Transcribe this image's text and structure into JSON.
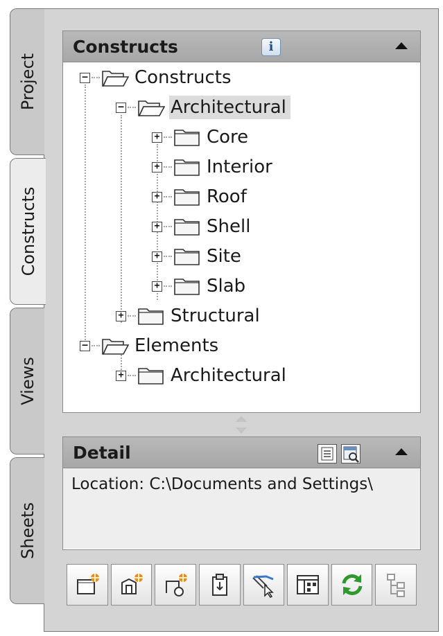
{
  "tabs": [
    {
      "label": "Project",
      "active": false
    },
    {
      "label": "Constructs",
      "active": true
    },
    {
      "label": "Views",
      "active": false
    },
    {
      "label": "Sheets",
      "active": false
    }
  ],
  "constructs_panel": {
    "title": "Constructs",
    "info_icon": "info-icon",
    "tree": [
      {
        "label": "Constructs",
        "state": "expanded",
        "icon": "folder-open-icon",
        "depth": 0
      },
      {
        "label": "Architectural",
        "state": "expanded",
        "icon": "folder-open-icon",
        "depth": 1,
        "selected": true
      },
      {
        "label": "Core",
        "state": "collapsed",
        "icon": "folder-icon",
        "depth": 2
      },
      {
        "label": "Interior",
        "state": "collapsed",
        "icon": "folder-icon",
        "depth": 2
      },
      {
        "label": "Roof",
        "state": "collapsed",
        "icon": "folder-icon",
        "depth": 2
      },
      {
        "label": "Shell",
        "state": "collapsed",
        "icon": "folder-icon",
        "depth": 2
      },
      {
        "label": "Site",
        "state": "collapsed",
        "icon": "folder-icon",
        "depth": 2
      },
      {
        "label": "Slab",
        "state": "collapsed",
        "icon": "folder-icon",
        "depth": 2
      },
      {
        "label": "Structural",
        "state": "collapsed",
        "icon": "folder-icon",
        "depth": 1
      },
      {
        "label": "Elements",
        "state": "expanded",
        "icon": "folder-open-icon",
        "depth": 0
      },
      {
        "label": "Architectural",
        "state": "collapsed",
        "icon": "folder-icon",
        "depth": 1
      }
    ]
  },
  "detail_panel": {
    "title": "Detail",
    "location_text": "Location: C:\\Documents and Settings\\",
    "icons": [
      "list-view-icon",
      "preview-icon"
    ]
  },
  "toolbar": {
    "buttons": [
      "new-category-icon",
      "new-construct-icon",
      "new-element-icon",
      "paste-icon",
      "xref-select-icon",
      "layout-icon",
      "refresh-icon",
      "hierarchy-icon"
    ]
  },
  "colors": {
    "panel_header": "#aeaeae",
    "frame": "#d4d4d4",
    "selection": "#dcdcdc",
    "refresh_green": "#2e9a2e",
    "new_star_orange": "#f08a1c"
  }
}
